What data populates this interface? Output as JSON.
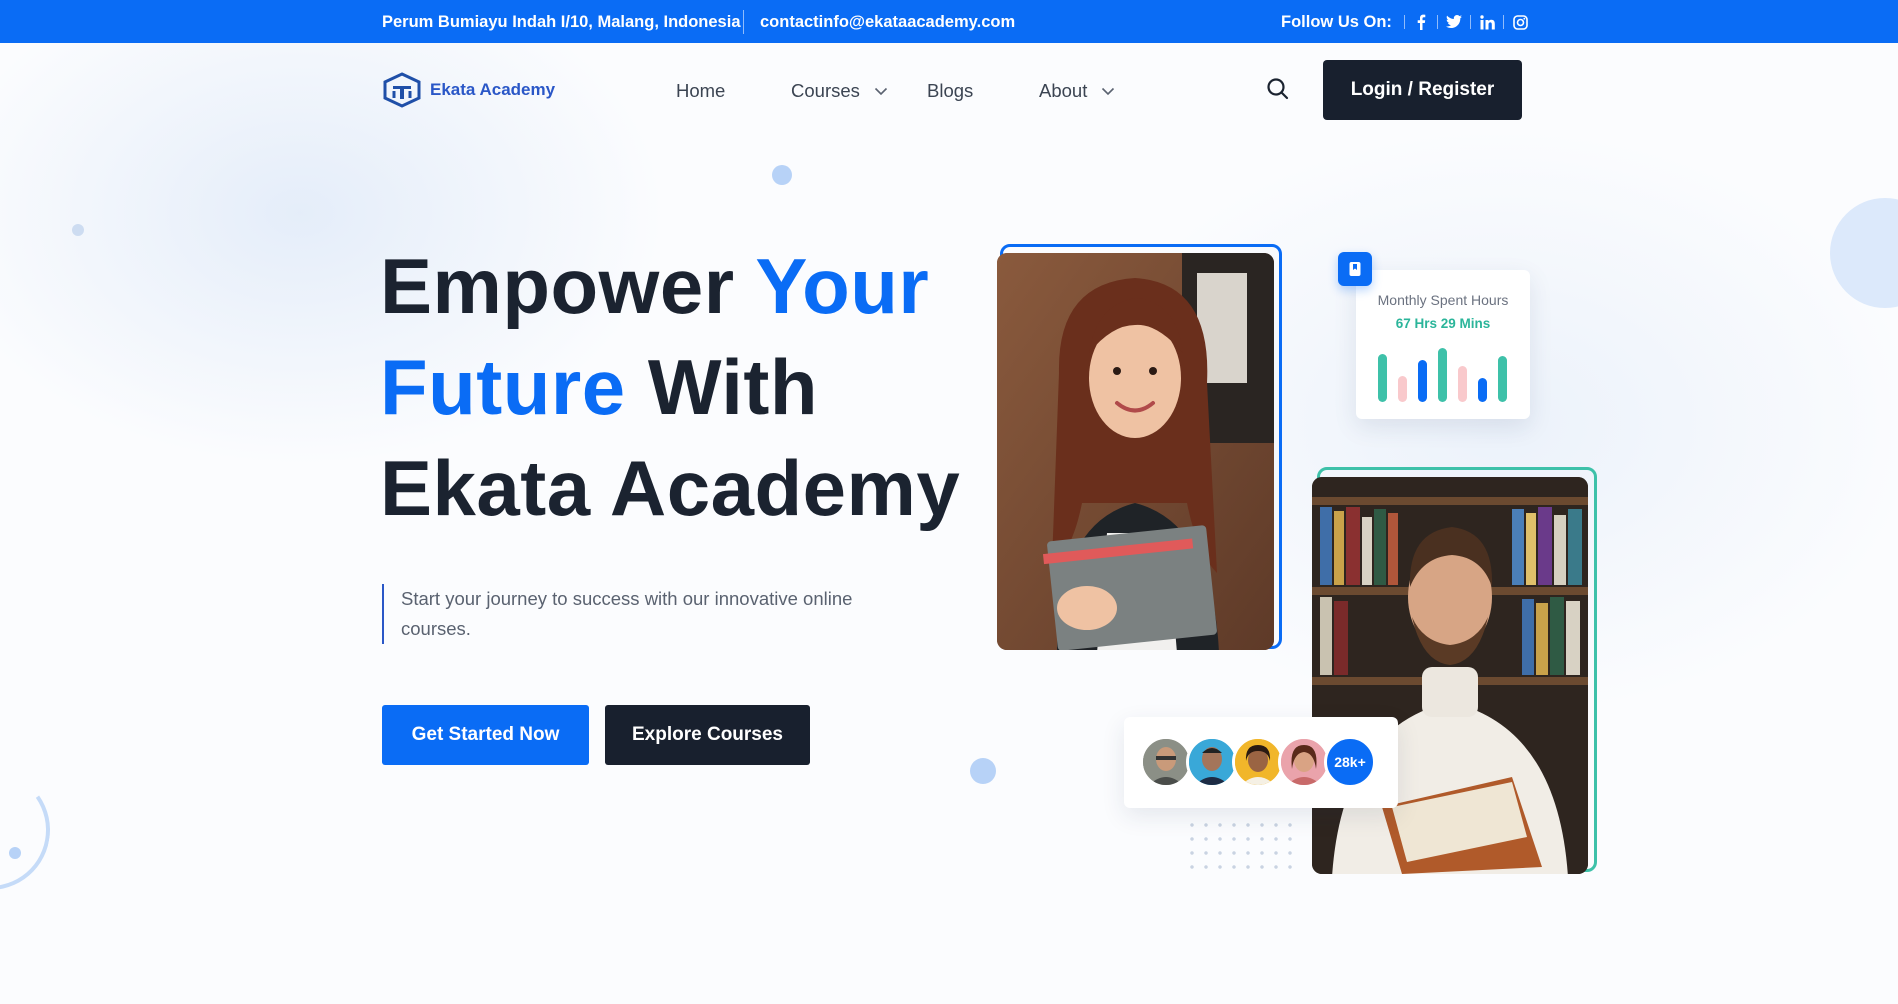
{
  "topbar": {
    "address": "Perum Bumiayu Indah I/10, Malang, Indonesia",
    "email": "contactinfo@ekataacademy.com",
    "follow_label": "Follow Us On:",
    "social_icons": [
      "facebook-icon",
      "twitter-icon",
      "linkedin-icon",
      "instagram-icon"
    ]
  },
  "brand": {
    "name": "Ekata Academy",
    "color": "#2a57c7"
  },
  "nav": {
    "items": [
      {
        "label": "Home",
        "has_dropdown": false
      },
      {
        "label": "Courses",
        "has_dropdown": true
      },
      {
        "label": "Blogs",
        "has_dropdown": false
      },
      {
        "label": "About",
        "has_dropdown": true
      }
    ],
    "search_icon": "search-icon",
    "login_label": "Login / Register"
  },
  "hero": {
    "headline_part1": "Empower ",
    "headline_part2": "Your",
    "headline_part3": "Future",
    "headline_part4": " With",
    "headline_part5": "Ekata Academy",
    "subtext": "Start your journey to success with our innovative online courses.",
    "primary_cta": "Get Started Now",
    "secondary_cta": "Explore Courses"
  },
  "stat_card": {
    "title": "Monthly Spent Hours",
    "value": "67 Hrs 29 Mins",
    "badge_icon": "bookmark-icon"
  },
  "community": {
    "count_label": "28k+"
  },
  "colors": {
    "accent": "#0a6cf5",
    "dark": "#18202e",
    "teal": "#3ec1a9",
    "pink": "#f9c9cc"
  }
}
